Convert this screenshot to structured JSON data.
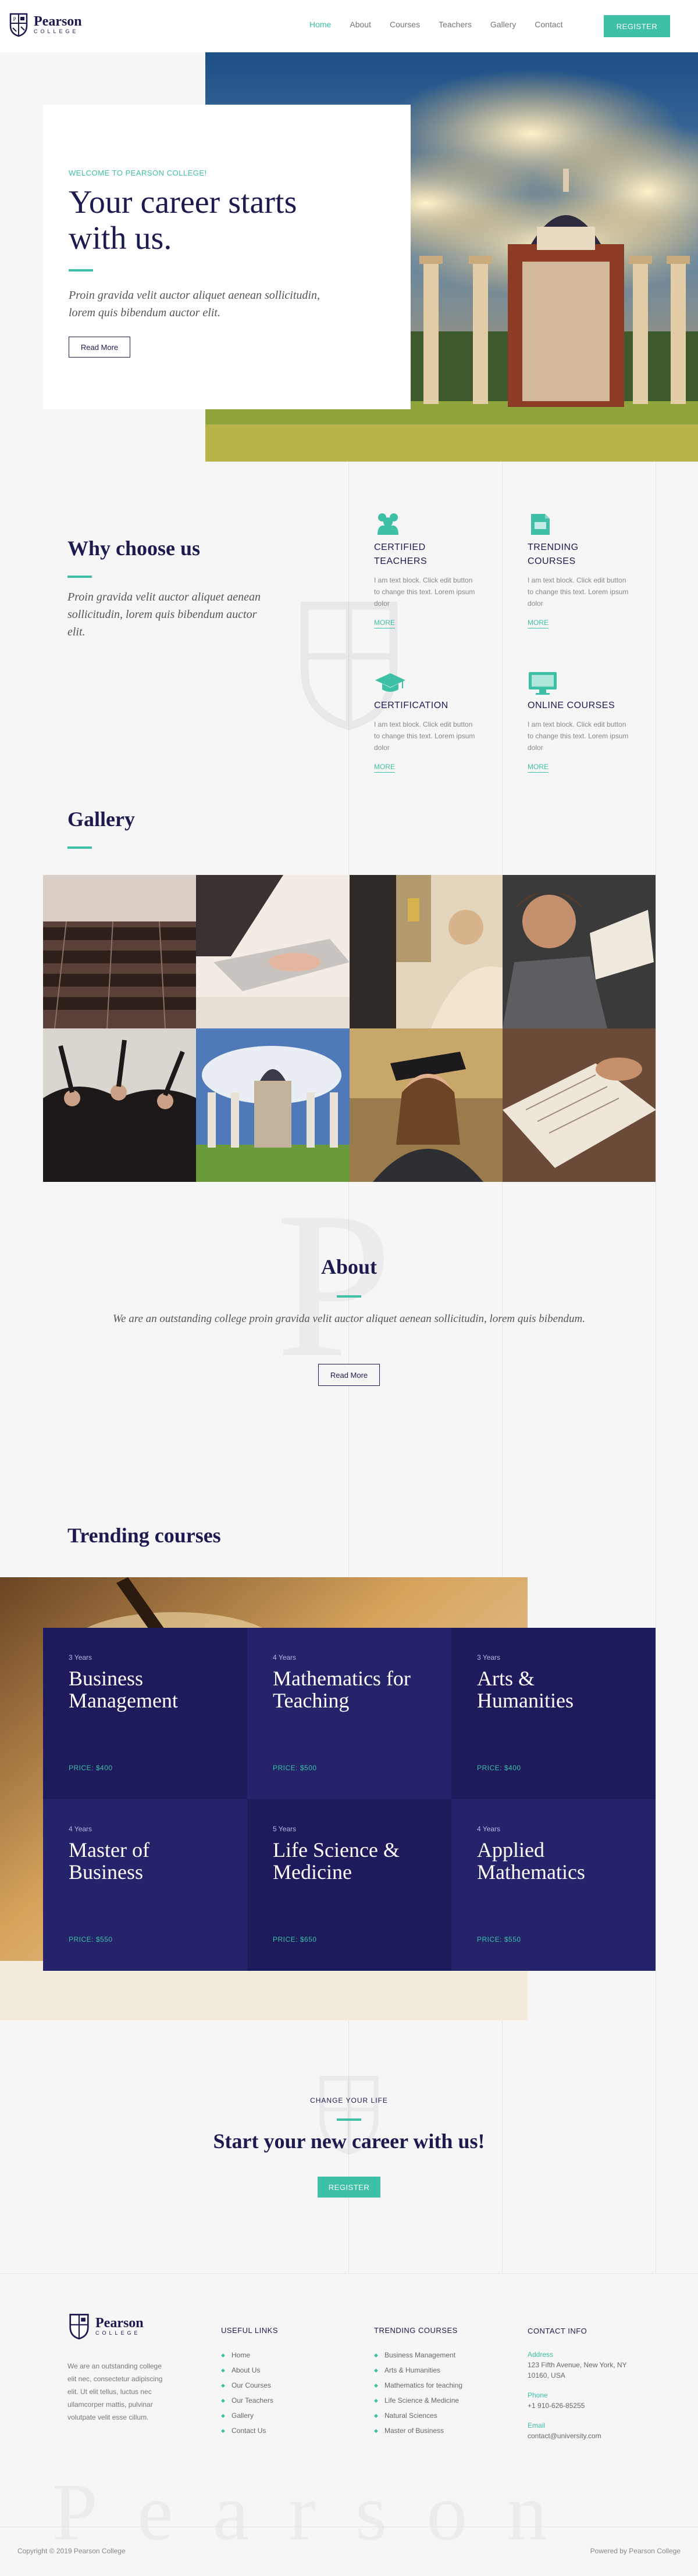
{
  "brand": {
    "name": "Pearson",
    "sub": "COLLEGE",
    "accent": "#3dc0a5",
    "navy": "#1c1b4f"
  },
  "nav": {
    "items": [
      "Home",
      "About",
      "Courses",
      "Teachers",
      "Gallery",
      "Contact"
    ],
    "active": "Home",
    "register": "REGISTER"
  },
  "hero": {
    "eyebrow": "WELCOME TO PEARSON COLLEGE!",
    "title_line1": "Your career starts",
    "title_line2": "with us.",
    "text": "Proin gravida velit auctor aliquet aenean sollicitudin, lorem quis bibendum auctor elit.",
    "button": "Read More"
  },
  "why": {
    "title": "Why choose us",
    "text": "Proin gravida velit auctor aliquet aenean sollicitudin, lorem quis bibendum auctor elit.",
    "features": [
      {
        "icon": "teachers-icon",
        "title_line1": "CERTIFIED",
        "title_line2": "TEACHERS",
        "text": "I am text block. Click edit button to change this text. Lorem ipsum dolor",
        "more": "MORE"
      },
      {
        "icon": "book-icon",
        "title_line1": "TRENDING",
        "title_line2": "COURSES",
        "text": "I am text block. Click edit button to change this text. Lorem ipsum dolor",
        "more": "MORE"
      },
      {
        "icon": "graduation-cap-icon",
        "title_line1": "CERTIFICATION",
        "title_line2": "",
        "text": "I am text block. Click edit button to change this text. Lorem ipsum dolor",
        "more": "MORE"
      },
      {
        "icon": "monitor-icon",
        "title_line1": "ONLINE COURSES",
        "title_line2": "",
        "text": "I am text block. Click edit button to change this text. Lorem ipsum dolor",
        "more": "MORE"
      }
    ]
  },
  "gallery": {
    "title": "Gallery"
  },
  "about": {
    "title": "About",
    "text": "We are an outstanding college proin gravida velit auctor aliquet aenean sollicitudin, lorem quis bibendum.",
    "button": "Read More"
  },
  "courses": {
    "title": "Trending courses",
    "items": [
      {
        "years": "3 Years",
        "title_line1": "Business",
        "title_line2": "Management",
        "price": "PRICE: $400"
      },
      {
        "years": "4 Years",
        "title_line1": "Mathematics for",
        "title_line2": "Teaching",
        "price": "PRICE: $500"
      },
      {
        "years": "3 Years",
        "title_line1": "Arts &",
        "title_line2": "Humanities",
        "price": "PRICE: $400"
      },
      {
        "years": "4 Years",
        "title_line1": "Master of",
        "title_line2": "Business",
        "price": "PRICE: $550"
      },
      {
        "years": "5 Years",
        "title_line1": "Life Science &",
        "title_line2": "Medicine",
        "price": "PRICE: $650"
      },
      {
        "years": "4 Years",
        "title_line1": "Applied",
        "title_line2": "Mathematics",
        "price": "PRICE: $550"
      }
    ]
  },
  "cta": {
    "eyebrow": "CHANGE YOUR LIFE",
    "title": "Start your new career with us!",
    "button": "REGISTER"
  },
  "footer": {
    "about_text": "We are an outstanding college elit nec, consectetur adipiscing elit. Ut elit tellus, luctus nec ullamcorper mattis, pulvinar volutpate velit esse cillum.",
    "useful_title": "USEFUL LINKS",
    "useful_links": [
      "Home",
      "About Us",
      "Our Courses",
      "Our Teachers",
      "Gallery",
      "Contact Us"
    ],
    "trending_title": "TRENDING COURSES",
    "trending_links": [
      "Business Management",
      "Arts & Humanities",
      "Mathematics for teaching",
      "Life Science & Medicine",
      "Natural Sciences",
      "Master of Business"
    ],
    "contact_title": "CONTACT INFO",
    "address_label": "Address",
    "address_line1": "123 Fifth Avenue, New York, NY",
    "address_line2": "10160, USA",
    "phone_label": "Phone",
    "phone": "+1 910-626-85255",
    "email_label": "Email",
    "email": "contact@university.com",
    "watermark": "Pearson",
    "copyright": "Copyright © 2019 Pearson College",
    "powered": "Powered by Pearson College"
  }
}
